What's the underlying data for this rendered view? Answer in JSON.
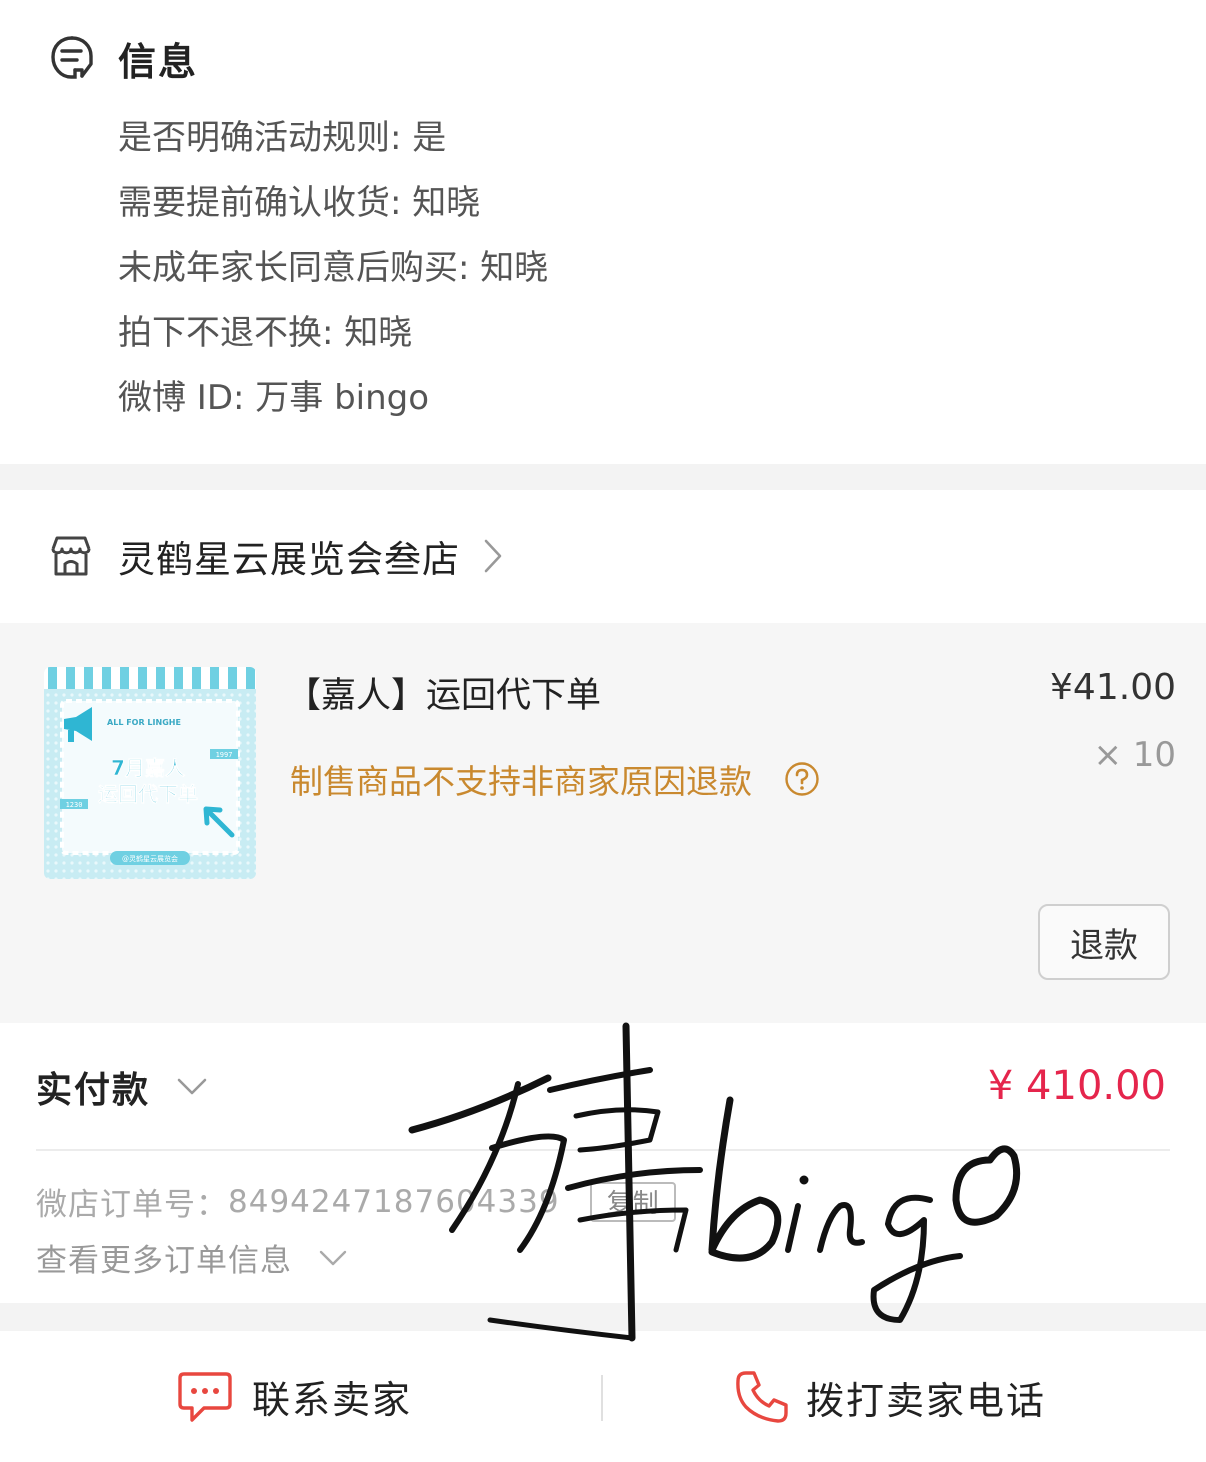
{
  "info": {
    "title": "信息",
    "icon": "note-icon",
    "lines": [
      "是否明确活动规则: 是",
      "需要提前确认收货: 知晓",
      "未成年家长同意后购买: 知晓",
      "拍下不退不换: 知晓",
      "微博 ID: 万事 bingo"
    ]
  },
  "store": {
    "name": "灵鹤星云展览会叁店",
    "icon": "store-icon"
  },
  "product": {
    "title": "【嘉人】运回代下单",
    "notice": "制售商品不支持非商家原因退款",
    "price": "¥41.00",
    "quantity": "× 10",
    "refund_label": "退款",
    "thumbnail": {
      "brand": "ALL FOR LINGHE",
      "line1": "7月嘉人",
      "line2": "运回代下单",
      "tag_left": "1230",
      "tag_right": "1997",
      "footer": "@灵鹤星云展览会"
    }
  },
  "payment": {
    "label": "实付款",
    "amount": "¥ 410.00",
    "order_label": "微店订单号：",
    "order_number": "8494247187604339",
    "copy_label": "复制",
    "more_label": "查看更多订单信息"
  },
  "bottom": {
    "contact_label": "联系卖家",
    "call_label": "拨打卖家电话"
  },
  "watermark": {
    "text": "万事bingo"
  },
  "colors": {
    "accent_red": "#e5254c",
    "notice_orange": "#c9892f",
    "icon_red": "#e8473f"
  }
}
